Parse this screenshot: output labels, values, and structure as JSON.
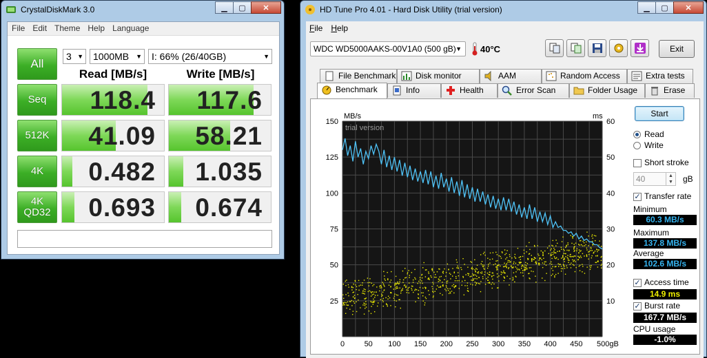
{
  "cdm": {
    "title": "CrystalDiskMark 3.0",
    "menu": [
      "File",
      "Edit",
      "Theme",
      "Help",
      "Language"
    ],
    "all_button": "All",
    "runs": "3",
    "size": "1000MB",
    "drive": "I: 66% (26/40GB)",
    "read_header": "Read [MB/s]",
    "write_header": "Write [MB/s]",
    "rows": [
      {
        "label": "Seq",
        "read": "118.4",
        "write": "117.6",
        "read_fill": 0.84,
        "write_fill": 0.83
      },
      {
        "label": "512K",
        "read": "41.09",
        "write": "58.21",
        "read_fill": 0.53,
        "write_fill": 0.6
      },
      {
        "label": "4K",
        "read": "0.482",
        "write": "1.035",
        "read_fill": 0.1,
        "write_fill": 0.14
      },
      {
        "label": "4K\nQD32",
        "read": "0.693",
        "write": "0.674",
        "read_fill": 0.12,
        "write_fill": 0.12
      }
    ],
    "status": ""
  },
  "hdt": {
    "title": "HD Tune Pro 4.01 - Hard Disk Utility (trial version)",
    "menu": [
      {
        "key": "F",
        "rest": "ile"
      },
      {
        "key": "H",
        "rest": "elp"
      }
    ],
    "drive": "WDC WD5000AAKS-00V1A0 (500 gB)",
    "temperature": "40°C",
    "exit": "Exit",
    "tabs_top": [
      "File Benchmark",
      "Disk monitor",
      "AAM",
      "Random Access",
      "Extra tests"
    ],
    "tabs_bottom": [
      "Benchmark",
      "Info",
      "Health",
      "Error Scan",
      "Folder Usage",
      "Erase"
    ],
    "active_tab": "Benchmark",
    "start": "Start",
    "read": "Read",
    "write": "Write",
    "mode": "read",
    "short_stroke": "Short stroke",
    "short_stroke_checked": false,
    "stroke_value": "40",
    "stroke_unit": "gB",
    "transfer_rate": "Transfer rate",
    "transfer_rate_checked": true,
    "minimum_label": "Minimum",
    "minimum": "60.3 MB/s",
    "maximum_label": "Maximum",
    "maximum": "137.8 MB/s",
    "average_label": "Average",
    "average": "102.6 MB/s",
    "access_time_label": "Access time",
    "access_time_checked": true,
    "access_time": "14.9 ms",
    "burst_rate_label": "Burst rate",
    "burst_rate_checked": true,
    "burst_rate": "167.7 MB/s",
    "cpu_usage_label": "CPU usage",
    "cpu_usage": "-1.0%",
    "colors": {
      "transfer": "#4fc3f7",
      "access": "#f0f000",
      "value_blue": "#35b4f0",
      "value_yellow": "#f0f000",
      "value_white": "#ffffff"
    }
  },
  "chart_data": {
    "type": "line",
    "watermark": "trial version",
    "ylabel_left": "MB/s",
    "ylabel_right": "ms",
    "xunit": "gB",
    "xlim": [
      0,
      500
    ],
    "ylim_left": [
      0,
      150
    ],
    "ylim_right": [
      0,
      60
    ],
    "xticks": [
      0,
      50,
      100,
      150,
      200,
      250,
      300,
      350,
      400,
      450,
      500
    ],
    "yticks_left": [
      25,
      50,
      75,
      100,
      125,
      150
    ],
    "yticks_right": [
      10,
      20,
      30,
      40,
      50,
      60
    ],
    "grid": true,
    "series": [
      {
        "type": "line",
        "axis": "left",
        "x": [
          0,
          5,
          10,
          15,
          20,
          25,
          30,
          35,
          40,
          45,
          50,
          55,
          60,
          65,
          70,
          75,
          80,
          85,
          90,
          95,
          100,
          105,
          110,
          115,
          120,
          125,
          130,
          135,
          140,
          145,
          150,
          155,
          160,
          165,
          170,
          175,
          180,
          185,
          190,
          195,
          200,
          205,
          210,
          215,
          220,
          225,
          230,
          235,
          240,
          245,
          250,
          255,
          260,
          265,
          270,
          275,
          280,
          285,
          290,
          295,
          300,
          305,
          310,
          315,
          320,
          325,
          330,
          335,
          340,
          345,
          350,
          355,
          360,
          365,
          370,
          375,
          380,
          385,
          390,
          395,
          400,
          405,
          410,
          415,
          420,
          425,
          430,
          435,
          440,
          445,
          450,
          455,
          460,
          465,
          470,
          475,
          480,
          485,
          490,
          495,
          500
        ],
        "y": [
          130,
          138,
          126,
          133,
          122,
          136,
          125,
          131,
          120,
          129,
          124,
          133,
          127,
          134,
          129,
          120,
          130,
          118,
          126,
          116,
          125,
          115,
          123,
          112,
          121,
          111,
          119,
          109,
          117,
          108,
          115,
          107,
          116,
          106,
          115,
          104,
          112,
          103,
          114,
          104,
          110,
          101,
          111,
          100,
          108,
          98,
          109,
          97,
          106,
          96,
          104,
          94,
          103,
          94,
          101,
          92,
          99,
          90,
          98,
          89,
          96,
          88,
          97,
          88,
          96,
          87,
          94,
          85,
          92,
          83,
          90,
          82,
          92,
          82,
          90,
          80,
          87,
          80,
          86,
          78,
          84,
          76,
          80,
          76,
          77,
          74,
          74,
          72,
          73,
          70,
          72,
          68,
          70,
          67,
          68,
          66,
          66,
          64,
          64,
          62,
          61
        ]
      },
      {
        "type": "scatter",
        "axis": "right",
        "trend_start_ms": 10.5,
        "trend_end_ms": 24.5,
        "spread_ms": 6
      }
    ]
  }
}
